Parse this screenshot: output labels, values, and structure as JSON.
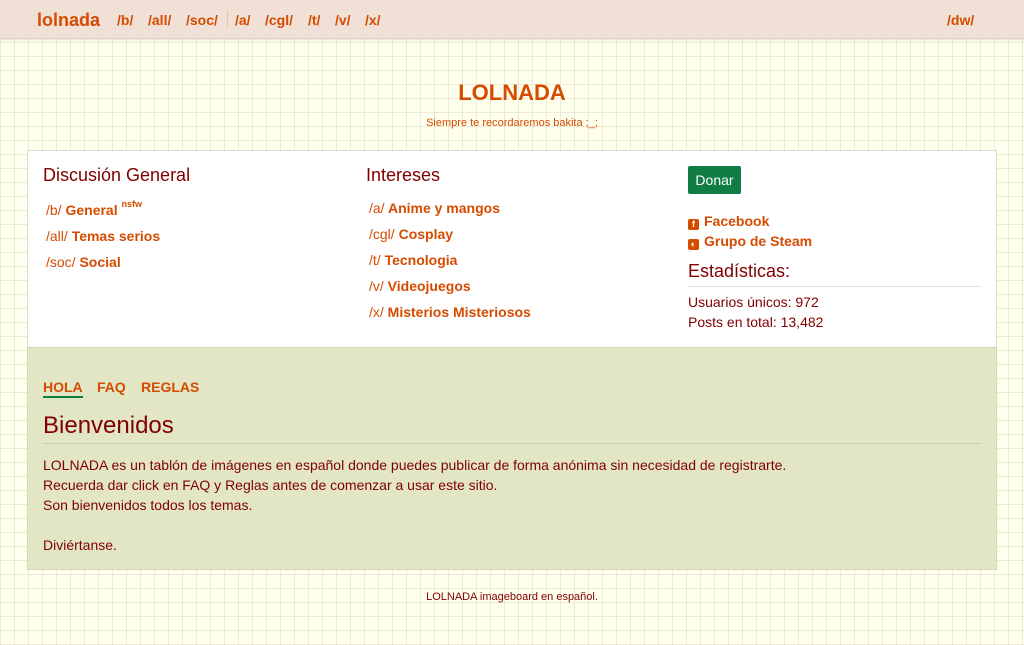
{
  "topbar": {
    "brand": "lolnada",
    "links": [
      "/b/",
      "/all/",
      "/soc/",
      "/a/",
      "/cgl/",
      "/t/",
      "/v/",
      "/x/"
    ],
    "right_link": "/dw/"
  },
  "header": {
    "title": "LOLNADA",
    "subtitle": "Siempre te recordaremos bakita ;_;"
  },
  "general": {
    "heading": "Discusión General",
    "boards": [
      {
        "code": "/b/",
        "name": "General",
        "tag": "nsfw"
      },
      {
        "code": "/all/",
        "name": "Temas serios"
      },
      {
        "code": "/soc/",
        "name": "Social"
      }
    ]
  },
  "interests": {
    "heading": "Intereses",
    "boards": [
      {
        "code": "/a/",
        "name": "Anime y mangos"
      },
      {
        "code": "/cgl/",
        "name": "Cosplay"
      },
      {
        "code": "/t/",
        "name": "Tecnologia"
      },
      {
        "code": "/v/",
        "name": "Videojuegos"
      },
      {
        "code": "/x/",
        "name": "Misterios Misteriosos"
      }
    ]
  },
  "sidebar": {
    "donate_label": "Donar",
    "social": [
      {
        "label": "Facebook",
        "icon": "facebook-icon"
      },
      {
        "label": "Grupo de Steam",
        "icon": "steam-icon"
      }
    ],
    "stats_title": "Estadísticas:",
    "stats": [
      "Usuarios únicos: 972",
      "Posts en total: 13,482"
    ]
  },
  "welcome": {
    "tabs": [
      "HOLA",
      "FAQ",
      "REGLAS"
    ],
    "active_tab": "HOLA",
    "title": "Bienvenidos",
    "lines": [
      "LOLNADA es un tablón de imágenes en español donde puedes publicar de forma anónima sin necesidad de registrarte.",
      "Recuerda dar click en FAQ y Reglas antes de comenzar a usar este sitio.",
      "Son bienvenidos todos los temas.",
      "Diviértanse."
    ]
  },
  "footer": "LOLNADA imageboard en español.",
  "colors": {
    "accent": "#d54b00",
    "text": "#800000",
    "donate": "#127c45",
    "topbar": "#f0e0d6"
  }
}
